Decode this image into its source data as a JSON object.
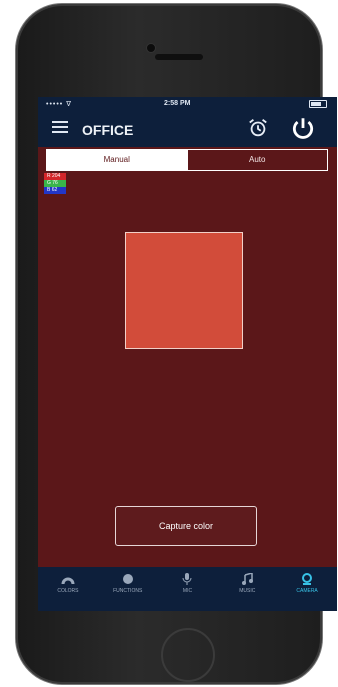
{
  "status": {
    "carrier": "••••• ∇",
    "time": "2:58 PM"
  },
  "nav": {
    "title": "OFFICE"
  },
  "segment": {
    "manual": "Manual",
    "auto": "Auto"
  },
  "rgb": {
    "r": "R 204",
    "g": "G 76",
    "b": "B 62",
    "r_color": "#d3262a",
    "g_color": "#39b54a",
    "b_color": "#2236c8"
  },
  "swatch_color": "#d24c3a",
  "capture_label": "Capture color",
  "tabs": [
    {
      "label": "COLORS",
      "icon": "arc-icon"
    },
    {
      "label": "FUNCTIONS",
      "icon": "circle-icon"
    },
    {
      "label": "MIC",
      "icon": "microphone-icon"
    },
    {
      "label": "MUSIC",
      "icon": "music-note-icon"
    },
    {
      "label": "CAMERA",
      "icon": "camera-icon",
      "active": true
    }
  ]
}
